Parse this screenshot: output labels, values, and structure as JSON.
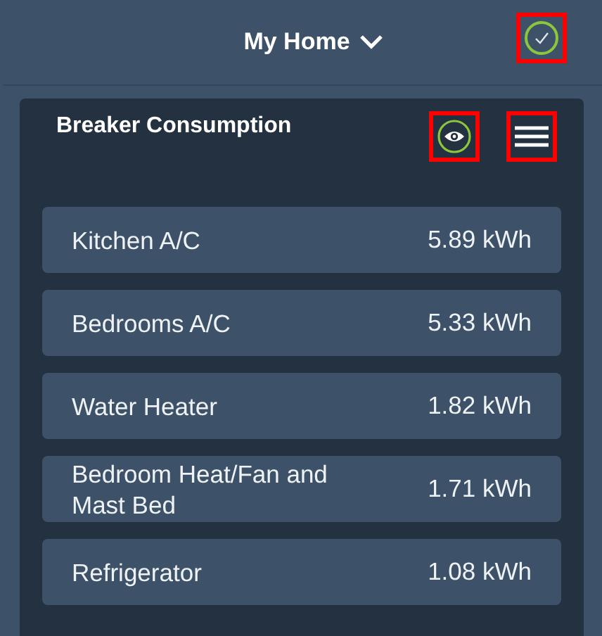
{
  "header": {
    "title": "My Home"
  },
  "card": {
    "title": "Breaker Consumption",
    "rows": [
      {
        "name": "Kitchen A/C",
        "value": "5.89 kWh"
      },
      {
        "name": "Bedrooms A/C",
        "value": "5.33 kWh"
      },
      {
        "name": "Water Heater",
        "value": "1.82 kWh"
      },
      {
        "name": "Bedroom Heat/Fan and Mast Bed",
        "value": "1.71 kWh"
      },
      {
        "name": "Refrigerator",
        "value": "1.08 kWh"
      }
    ]
  }
}
